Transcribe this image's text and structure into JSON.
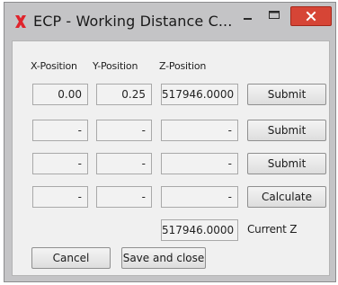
{
  "window": {
    "title": "ECP - Working Distance C...",
    "close_color": "#d64536"
  },
  "headers": {
    "x": "X-Position",
    "y": "Y-Position",
    "z": "Z-Position"
  },
  "rows": [
    {
      "x": "0.00",
      "y": "0.25",
      "z": "517946.0000",
      "button": "Submit"
    },
    {
      "x": "-",
      "y": "-",
      "z": "-",
      "button": "Submit"
    },
    {
      "x": "-",
      "y": "-",
      "z": "-",
      "button": "Submit"
    },
    {
      "x": "-",
      "y": "-",
      "z": "-",
      "button": "Calculate"
    }
  ],
  "current_z": {
    "value": "517946.0000",
    "label": "Current Z"
  },
  "footer": {
    "cancel_label": "Cancel",
    "save_label": "Save and close"
  },
  "icons": {
    "app": "x-logo-icon",
    "minimize": "minimize-icon",
    "maximize": "maximize-icon",
    "close": "close-icon"
  }
}
